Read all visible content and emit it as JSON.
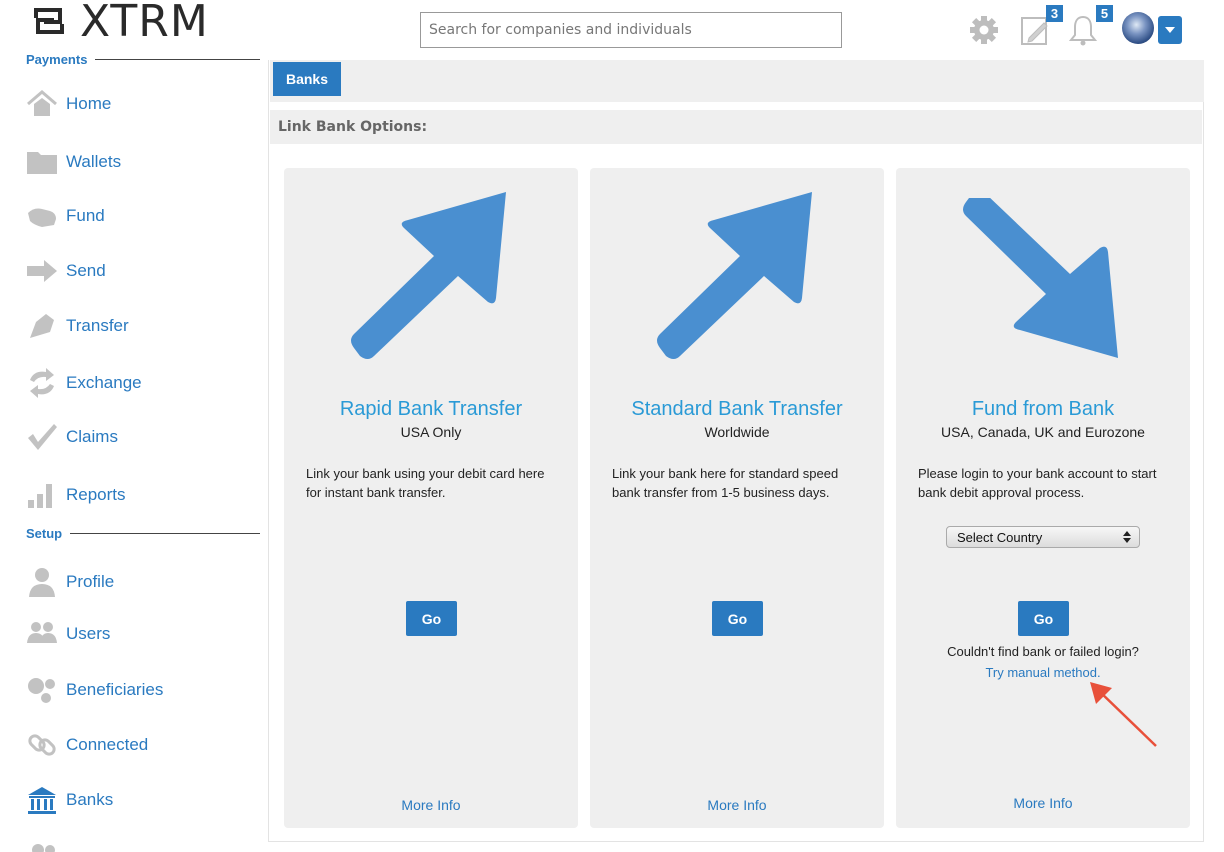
{
  "header": {
    "logo_text": "XTRM",
    "search_placeholder": "Search for companies and individuals",
    "notes_badge": "3",
    "alerts_badge": "5"
  },
  "sidebar": {
    "payments_heading": "Payments",
    "setup_heading": "Setup",
    "payments_items": [
      {
        "label": "Home",
        "icon": "home-icon"
      },
      {
        "label": "Wallets",
        "icon": "folder-icon"
      },
      {
        "label": "Fund",
        "icon": "hand-icon"
      },
      {
        "label": "Send",
        "icon": "arrow-right-icon"
      },
      {
        "label": "Transfer",
        "icon": "transfer-icon"
      },
      {
        "label": "Exchange",
        "icon": "exchange-icon"
      },
      {
        "label": "Claims",
        "icon": "checkmark-icon"
      },
      {
        "label": "Reports",
        "icon": "bar-chart-icon"
      }
    ],
    "setup_items": [
      {
        "label": "Profile",
        "icon": "person-icon"
      },
      {
        "label": "Users",
        "icon": "users-icon"
      },
      {
        "label": "Beneficiaries",
        "icon": "beneficiaries-icon"
      },
      {
        "label": "Connected",
        "icon": "link-icon"
      },
      {
        "label": "Banks",
        "icon": "bank-icon"
      }
    ]
  },
  "main": {
    "tab_label": "Banks",
    "options_heading": "Link Bank Options:",
    "cards": [
      {
        "title": "Rapid Bank Transfer",
        "subtitle": "USA Only",
        "description": "Link your bank using your debit card here for instant bank transfer.",
        "go_label": "Go",
        "more_label": "More Info"
      },
      {
        "title": "Standard Bank Transfer",
        "subtitle": "Worldwide",
        "description": "Link your bank here for standard speed bank transfer from 1-5 business days.",
        "go_label": "Go",
        "more_label": "More Info"
      },
      {
        "title": "Fund from Bank",
        "subtitle": "USA, Canada, UK and Eurozone",
        "description": "Please login to your bank account to start bank debit approval process.",
        "select_value": "Select Country",
        "go_label": "Go",
        "note": "Couldn't find bank or failed login?",
        "manual_link": "Try manual method.",
        "more_label": "More Info"
      }
    ]
  },
  "colors": {
    "brand_blue": "#2a7ac0",
    "title_blue": "#2a9ad6",
    "arrow_blue": "#4a8fd0",
    "annotation_red": "#e8503a"
  }
}
